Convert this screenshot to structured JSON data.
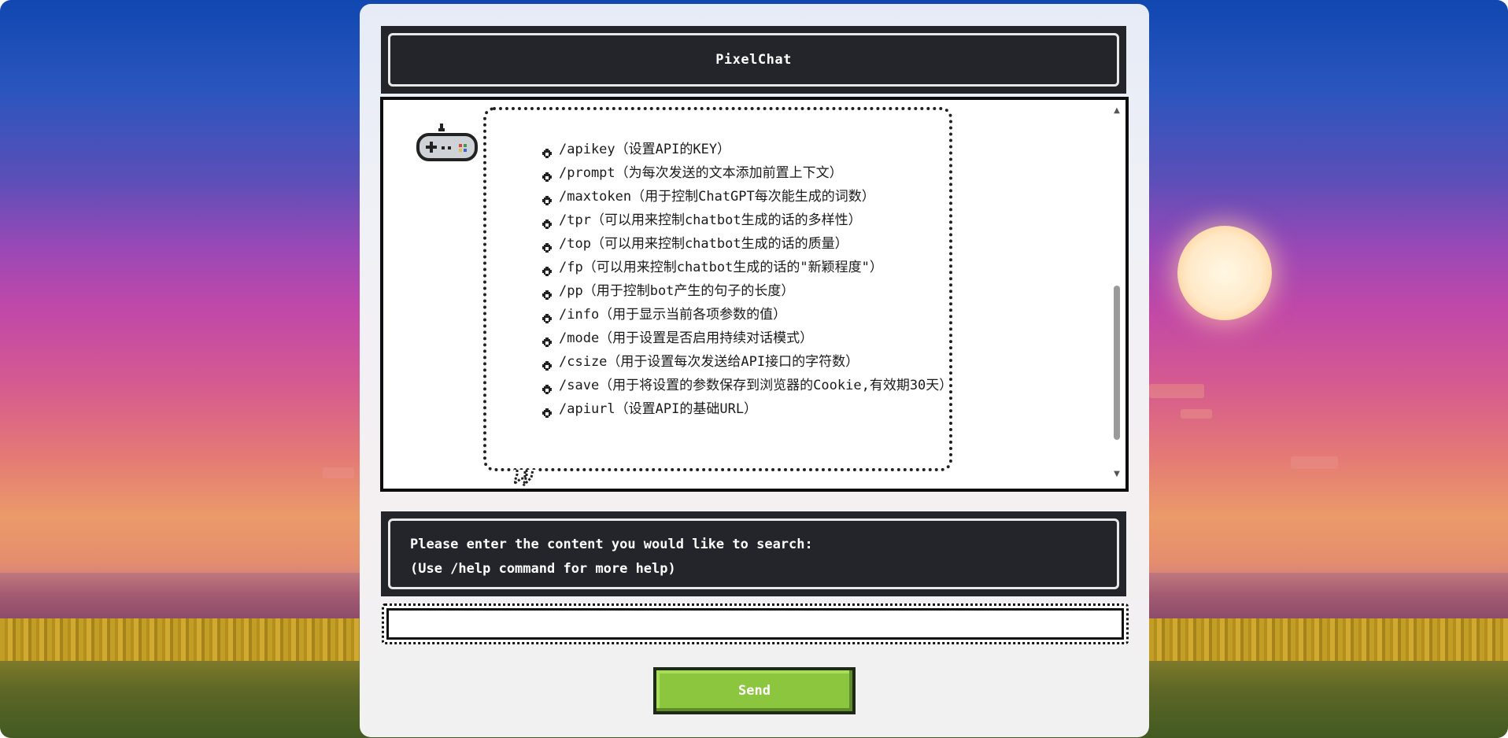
{
  "app": {
    "title": "PixelChat"
  },
  "chat": {
    "bot_avatar_icon": "gamepad-icon",
    "commands": [
      {
        "text": "/apikey（设置API的KEY）"
      },
      {
        "text": "/prompt（为每次发送的文本添加前置上下文）"
      },
      {
        "text": "/maxtoken（用于控制ChatGPT每次能生成的词数）"
      },
      {
        "text": "/tpr（可以用来控制chatbot生成的话的多样性）"
      },
      {
        "text": "/top（可以用来控制chatbot生成的话的质量）"
      },
      {
        "text": "/fp（可以用来控制chatbot生成的话的\"新颖程度\"）"
      },
      {
        "text": "/pp（用于控制bot产生的句子的长度）"
      },
      {
        "text": "/info（用于显示当前各项参数的值）"
      },
      {
        "text": "/mode（用于设置是否启用持续对话模式）"
      },
      {
        "text": "/csize（用于设置每次发送给API接口的字符数）"
      },
      {
        "text": "/save（用于将设置的参数保存到浏览器的Cookie,有效期30天）"
      },
      {
        "text": "/apiurl（设置API的基础URL）"
      }
    ]
  },
  "info": {
    "line1": "Please enter the content you would like to search:",
    "line2": "(Use /help command for more help)"
  },
  "input": {
    "value": "",
    "placeholder": ""
  },
  "send_button": {
    "label": "Send"
  },
  "colors": {
    "send_button": "#8cc63f",
    "header_bg": "#23252b",
    "panel_bg": "#f0f1f6"
  }
}
